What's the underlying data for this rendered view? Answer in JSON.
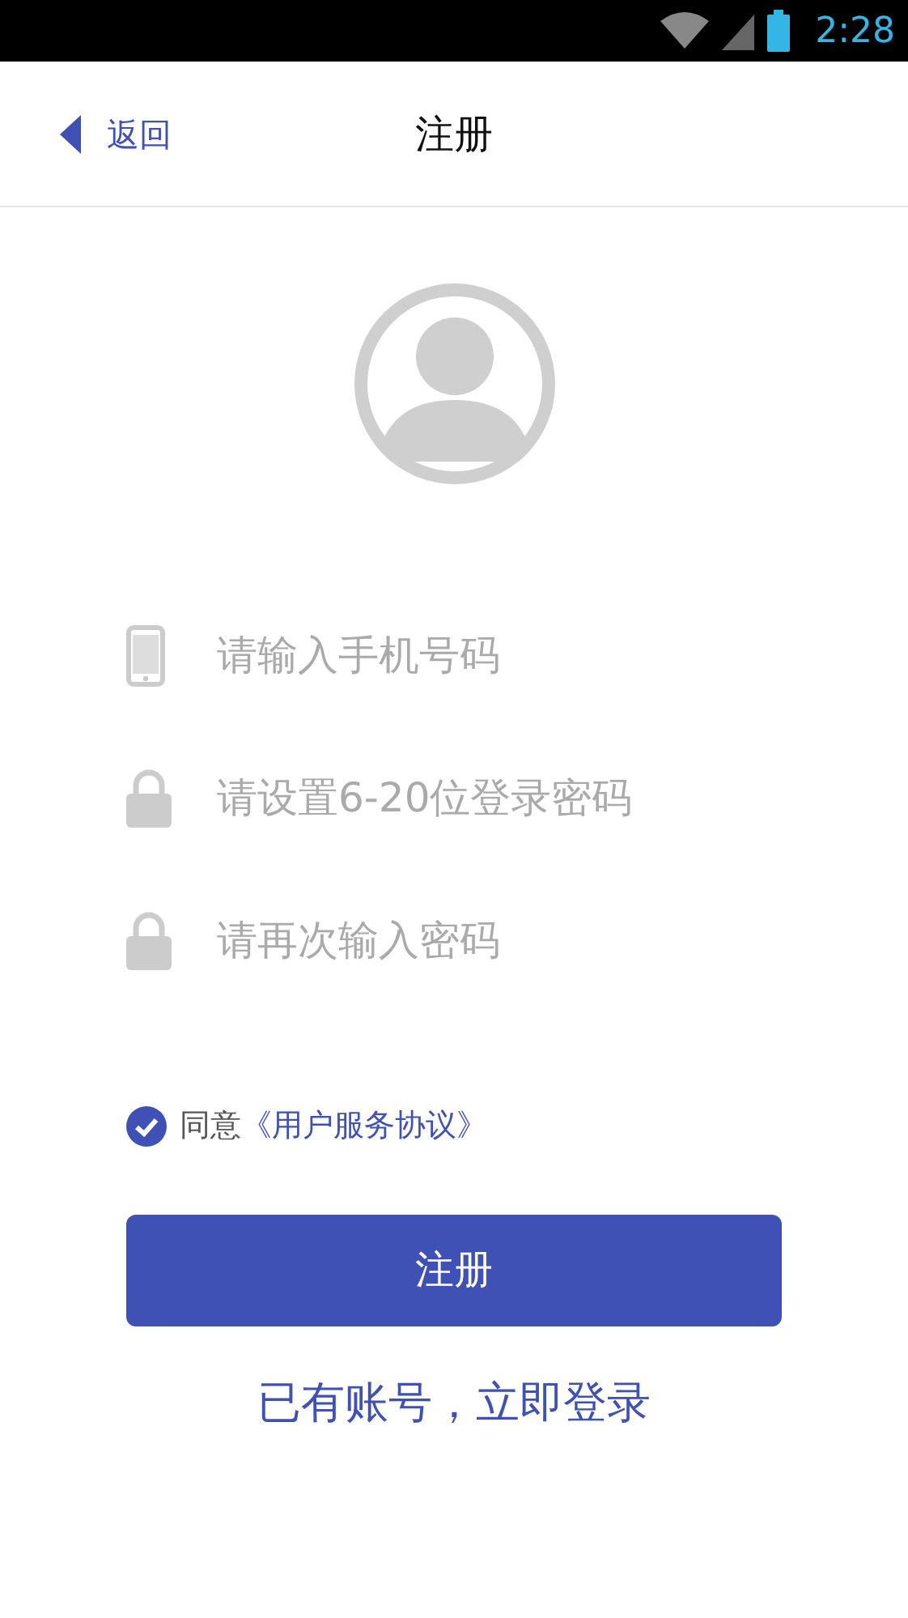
{
  "status_bar": {
    "time": "2:28"
  },
  "header": {
    "back": "返回",
    "title": "注册"
  },
  "fields": [
    {
      "kind": "phone",
      "placeholder": "请输入手机号码"
    },
    {
      "kind": "lock",
      "placeholder": "请设置6-20位登录密码"
    },
    {
      "kind": "lock",
      "placeholder": "请再次输入密码"
    }
  ],
  "agreement": {
    "checked": true,
    "label": "同意",
    "link": "《用户服务协议》"
  },
  "submit": "注册",
  "login_link": "已有账号，立即登录"
}
